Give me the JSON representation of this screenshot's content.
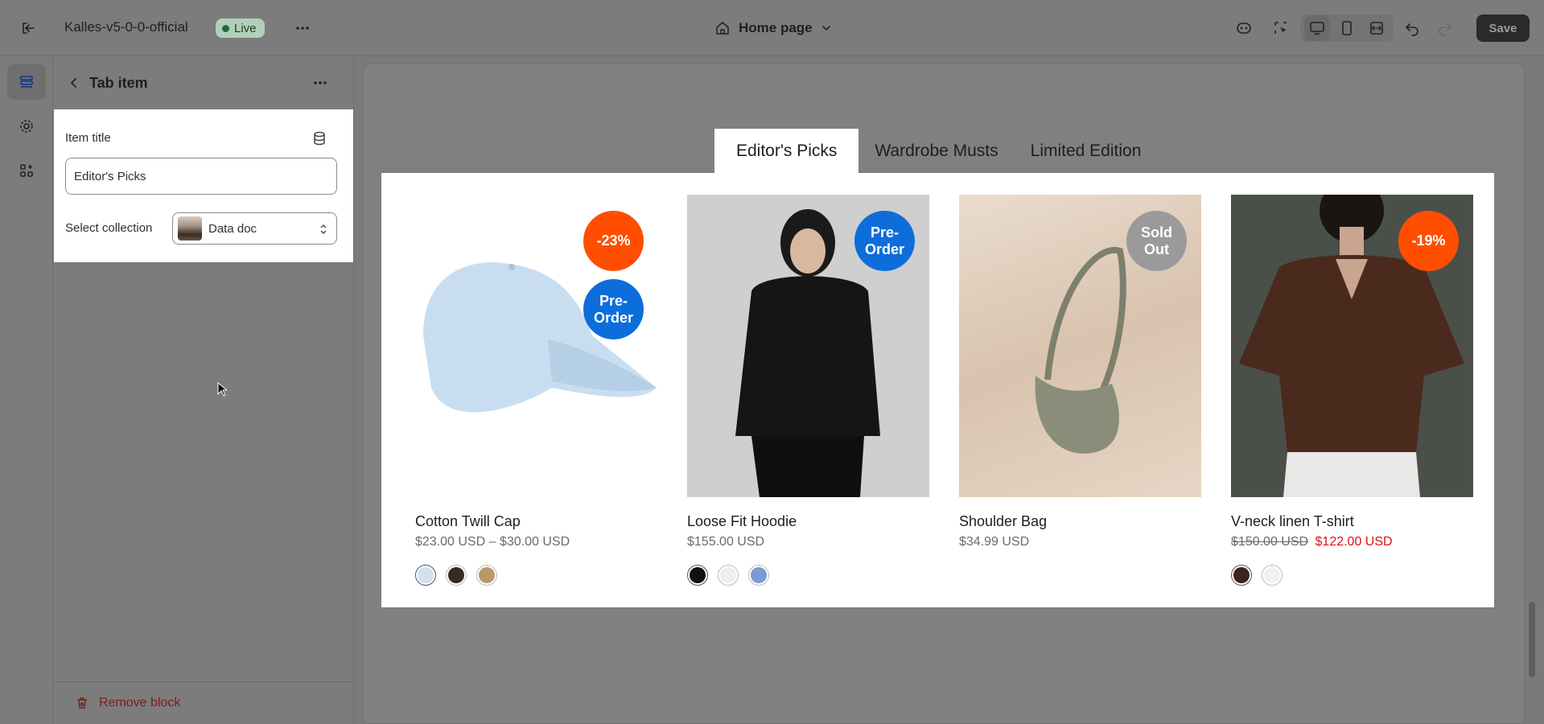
{
  "topbar": {
    "store_name": "Kalles-v5-0-0-official",
    "status_badge": "Live",
    "page_selector": "Home page",
    "save_label": "Save"
  },
  "sidebar": {
    "title": "Tab item",
    "item_title_label": "Item title",
    "item_title_value": "Editor's Picks",
    "select_collection_label": "Select collection",
    "collection_value": "Data doc",
    "remove_block_label": "Remove block"
  },
  "preview": {
    "tabs": [
      {
        "label": "Editor's Picks",
        "active": true
      },
      {
        "label": "Wardrobe Musts",
        "active": false
      },
      {
        "label": "Limited Edition",
        "active": false
      }
    ],
    "products": [
      {
        "name": "Cotton Twill Cap",
        "price": "$23.00 USD – $30.00 USD",
        "badges": [
          {
            "text": "-23%",
            "kind": "sale"
          },
          {
            "text": "Pre-\nOrder",
            "kind": "pre"
          }
        ],
        "swatches": [
          "#cfe2f2",
          "#3a2a22",
          "#b89a6a"
        ]
      },
      {
        "name": "Loose Fit Hoodie",
        "price": "$155.00 USD",
        "badges": [
          {
            "text": "Pre-\nOrder",
            "kind": "pre"
          }
        ],
        "swatches": [
          "#111111",
          "#eeeeee",
          "#7a9ad0"
        ]
      },
      {
        "name": "Shoulder Bag",
        "price": "$34.99 USD",
        "badges": [
          {
            "text": "Sold\nOut",
            "kind": "sold"
          }
        ],
        "swatches": []
      },
      {
        "name": "V-neck linen T-shirt",
        "price_old": "$150.00 USD",
        "price_new": "$122.00 USD",
        "badges": [
          {
            "text": "-19%",
            "kind": "sale"
          }
        ],
        "swatches": [
          "#3b2418",
          "#f1f1f1"
        ]
      }
    ]
  },
  "colors": {
    "sale": "#ff4e00",
    "preorder": "#0d6edb",
    "soldout": "#9a9a9a",
    "discount_price": "#e01010"
  }
}
